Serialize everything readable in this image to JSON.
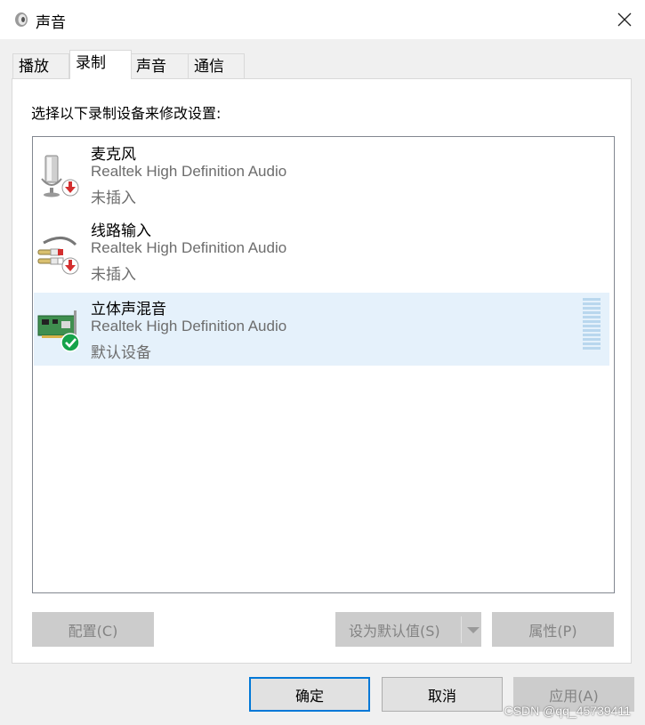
{
  "window": {
    "title": "声音",
    "icon": "speaker-icon",
    "close_icon": "close-icon"
  },
  "tabs": [
    {
      "label": "播放",
      "active": false
    },
    {
      "label": "录制",
      "active": true
    },
    {
      "label": "声音",
      "active": false
    },
    {
      "label": "通信",
      "active": false
    }
  ],
  "recording": {
    "instruction": "选择以下录制设备来修改设置:",
    "devices": [
      {
        "name": "麦克风",
        "driver": "Realtek High Definition Audio",
        "status": "未插入",
        "icon": "microphone-icon",
        "badge": "unplugged-badge-icon",
        "selected": false
      },
      {
        "name": "线路输入",
        "driver": "Realtek High Definition Audio",
        "status": "未插入",
        "icon": "line-in-cable-icon",
        "badge": "unplugged-badge-icon",
        "selected": false
      },
      {
        "name": "立体声混音",
        "driver": "Realtek High Definition Audio",
        "status": "默认设备",
        "icon": "sound-card-icon",
        "badge": "default-check-badge-icon",
        "selected": true
      }
    ],
    "buttons": {
      "configure": "配置(C)",
      "set_default": "设为默认值(S)",
      "properties": "属性(P)"
    }
  },
  "footer": {
    "ok": "确定",
    "cancel": "取消",
    "apply": "应用(A)"
  },
  "watermark": "CSDN @qq_45739411",
  "colors": {
    "selection": "#e5f1fb",
    "accent": "#0078d7",
    "disabled_button": "#cccccc",
    "level_meter": "#b9d7ee"
  }
}
